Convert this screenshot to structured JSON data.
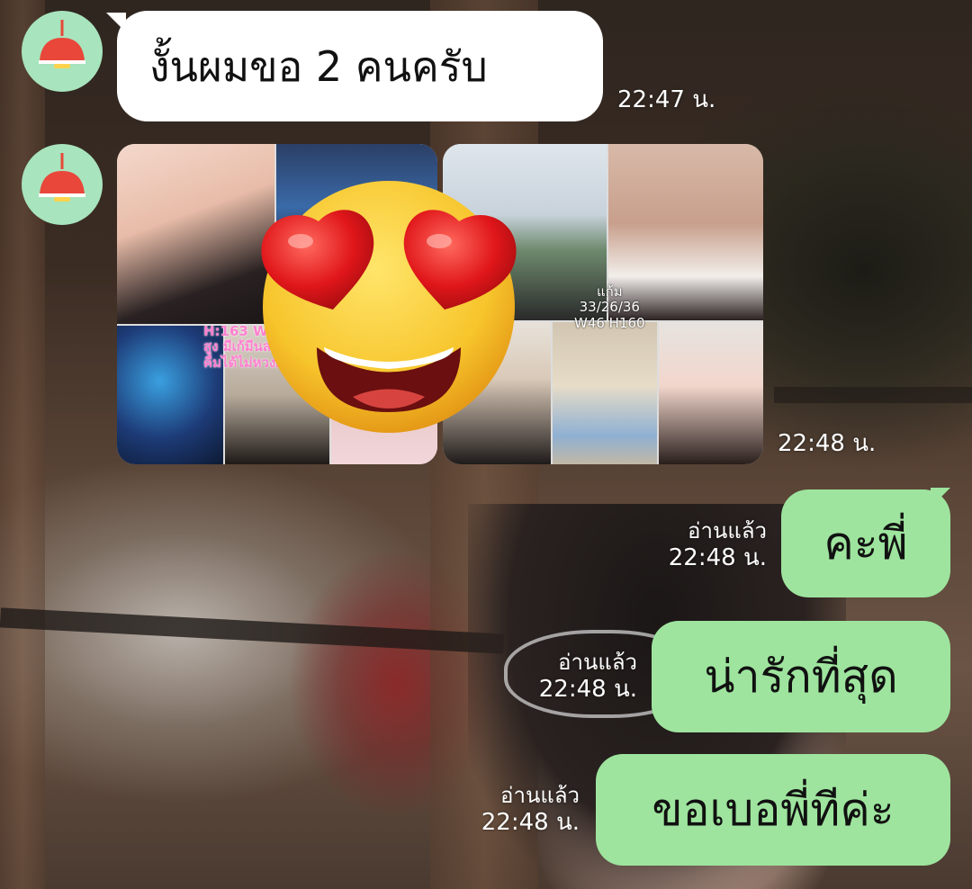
{
  "messages": [
    {
      "text": "งั้นผมขอ 2 คนครับ",
      "time": "22:47 น."
    },
    {
      "image_time": "22:48 น.",
      "collage_left": {
        "caption_line1": "H:163 W:",
        "caption_line2": "สูง มีเก้มีนสะ",
        "caption_line3": "คื่มได้ไม่หวงผ"
      },
      "collage_right": {
        "caption_line1": "แก้ม",
        "caption_line2": "33/26/36",
        "caption_line3": "W46 H160"
      },
      "sticker": "heart-eyes-emoji"
    }
  ],
  "replies": [
    {
      "text": "คะพี่",
      "status": "อ่านแล้ว",
      "time": "22:48 น."
    },
    {
      "text": "น่ารักที่สุด",
      "status": "อ่านแล้ว",
      "time": "22:48 น."
    },
    {
      "text": "ขอเบอพี่ทีค่ะ",
      "status": "อ่านแล้ว",
      "time": "22:48 น."
    }
  ],
  "colors": {
    "incoming_bubble": "#ffffff",
    "outgoing_bubble": "#9ee49e",
    "avatar_bg": "#a8e4bd",
    "lamp_red": "#e8473a"
  },
  "icons": {
    "avatar": "lamp-icon"
  }
}
